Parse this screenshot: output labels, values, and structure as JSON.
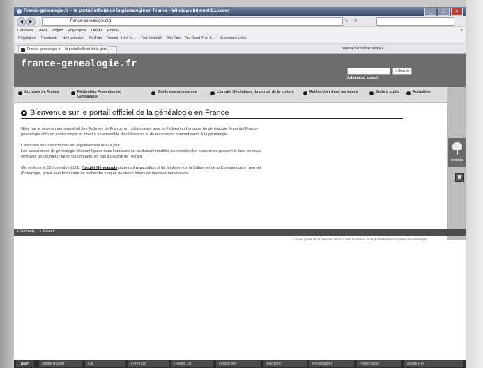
{
  "browser": {
    "title": "France-genealogie.fr -- le portail officiel de la généalogie en France - Windows Internet Explorer",
    "url": "france-genealogie.org",
    "address_controls": "↻ ✕",
    "menu": [
      "Datoteka",
      "Uredi",
      "Pogled",
      "Priljubljene",
      "Orodja",
      "Pomoč"
    ],
    "favorites": [
      "Priljubljene",
      "Facebook",
      "Nov povezek",
      "YouTube - Tutorial - How to...",
      "Free Hotmail",
      "YouTube - The Good That It...",
      "Customize Links"
    ],
    "tab_label": "France-genealogie.fr -- le portail officiel de la géné...",
    "command_bar": "Stran ▾  Varnost ▾  Orodja ▾",
    "window_buttons": {
      "minimize": "_",
      "maximize": "□",
      "close": "×"
    },
    "menu_close": "×"
  },
  "site": {
    "title": "france-genealogie.fr",
    "search_button": "» Search",
    "advanced_search": "Advanced search",
    "nav": [
      "Archives de France",
      "Fédération Française de Généalogie",
      "Guide des ressources",
      "L'onglet Généalogie du portail de la culture",
      "Rechercher dans les bases",
      "Boîte à outils",
      "Actualités"
    ],
    "heading": "Bienvenue sur le portail officiel de la généalogie en France",
    "para1": [
      "Géré par le service interministériel des Archives de France, en collaboration avec la Fédération française de généalogie, le portail France-",
      "généalogie offre un accès simple et direct à un ensemble de références et de ressources pouvant servir à la généalogie."
    ],
    "para2": [
      "L'annuaire des associations est régulièrement tenu à jour.",
      "Les associations de généalogie désirant figurer dans l'annuaire ou souhaitant modifier les données les concernant peuvent le faire en nous",
      "envoyant un courriel (cliquer sur contacts, en bas à gauche de l'écran)."
    ],
    "para3_prefix": "Mis en ligne le 12 novembre 2008, ",
    "para3_link": "l'onglet Généalogie",
    "para3_suffix": " du portail www.culture.fr du Ministère de la Culture et de la Communication permet",
    "para3_line2": "d'interroger, grâce à un formulaire de recherche unique, plusieurs bases de données nominatives.",
    "footer_links": [
      "Contacts",
      "Accueil"
    ],
    "footnote": "Le site portail de la Direction des Archives de France et de la Fédération Française de Généalogie",
    "nomina_label": "nomina"
  },
  "taskbar": {
    "start": "Start",
    "items": [
      "Adobe Reader",
      "Kal",
      "Kl Portals",
      "Google Ch",
      "France-gen",
      "Word doc",
      "Presentation",
      "Presentation",
      "Adobe Rea"
    ]
  }
}
